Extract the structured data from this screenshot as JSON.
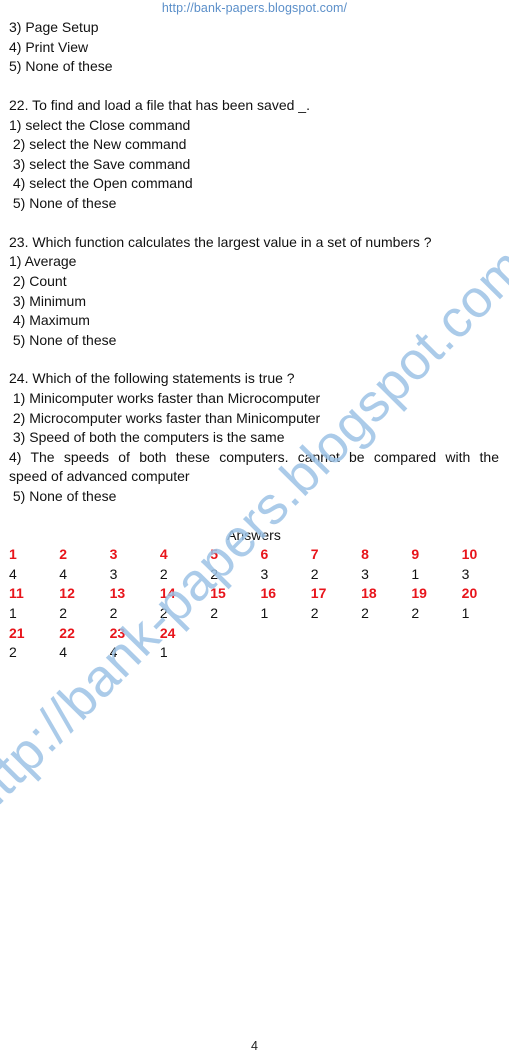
{
  "header": {
    "url": "http://bank-papers.blogspot.com/"
  },
  "carryover_options": [
    "3) Page Setup",
    "4) Print View",
    "5) None of these"
  ],
  "questions": [
    {
      "number": 22,
      "text": "22. To find and load a file that has been saved _.",
      "options": [
        "1) select the Close command",
        " 2) select the New command",
        " 3) select the Save command",
        " 4) select the Open command",
        " 5) None of these"
      ]
    },
    {
      "number": 23,
      "text": "23. Which function calculates the largest value in a set of numbers ?",
      "options": [
        "1) Average",
        " 2) Count",
        " 3) Minimum",
        " 4) Maximum",
        " 5) None of these"
      ]
    },
    {
      "number": 24,
      "text": "24. Which of the following statements is true ?",
      "options": [
        " 1) Minicomputer works faster than Microcomputer",
        " 2) Microcomputer works faster than Minicomputer",
        " 3) Speed of both the computers is the same",
        " 4) The speeds of both these computers. cannot be compared with the",
        "speed of advanced computer",
        " 5) None of these"
      ]
    }
  ],
  "answers": {
    "title": "Answers",
    "rows": [
      {
        "questions": [
          "1",
          "2",
          "3",
          "4",
          "5",
          "6",
          "7",
          "8",
          "9",
          "10"
        ],
        "answers": [
          "4",
          "4",
          "3",
          "2",
          "2",
          "3",
          "2",
          "3",
          "1",
          "3"
        ]
      },
      {
        "questions": [
          "11",
          "12",
          "13",
          "14",
          "15",
          "16",
          "17",
          "18",
          "19",
          "20"
        ],
        "answers": [
          "1",
          "2",
          "2",
          "2",
          "2",
          "1",
          "2",
          "2",
          "2",
          "1"
        ]
      },
      {
        "questions": [
          "21",
          "22",
          "23",
          "24"
        ],
        "answers": [
          "2",
          "4",
          "4",
          "1"
        ]
      }
    ],
    "colors": {
      "question_number": "#e8141b",
      "answer": "#111111"
    }
  },
  "watermark": {
    "text": "http://bank-papers.blogspot.com/",
    "color": "#9dc3e6"
  },
  "footer": {
    "page_number": "4"
  }
}
